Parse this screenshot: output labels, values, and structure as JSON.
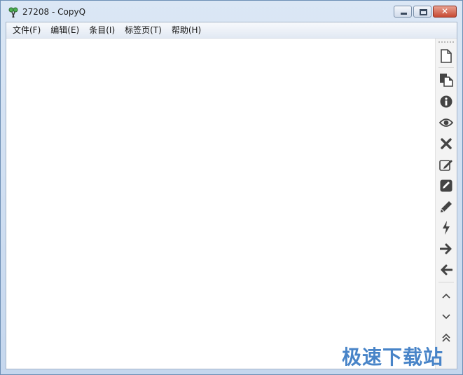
{
  "window": {
    "title": "27208 - CopyQ",
    "icon": "copyq-scissors-icon"
  },
  "menubar": {
    "items": [
      {
        "label": "文件(F)"
      },
      {
        "label": "编辑(E)"
      },
      {
        "label": "条目(I)"
      },
      {
        "label": "标签页(T)"
      },
      {
        "label": "帮助(H)"
      }
    ]
  },
  "toolbar": {
    "buttons": [
      "new-document-icon",
      "copy-icon",
      "info-icon",
      "eye-icon",
      "remove-x-icon",
      "edit-external-icon",
      "edit-notes-icon",
      "pencil-icon",
      "lightning-action-icon",
      "arrow-right-icon",
      "arrow-left-icon",
      "chevron-up-icon",
      "chevron-down-icon",
      "double-chevron-up-icon"
    ]
  },
  "watermark": "极速下载站",
  "colors": {
    "frame": "#c5d7ee",
    "close_button": "#c74a33",
    "icon": "#444444"
  }
}
